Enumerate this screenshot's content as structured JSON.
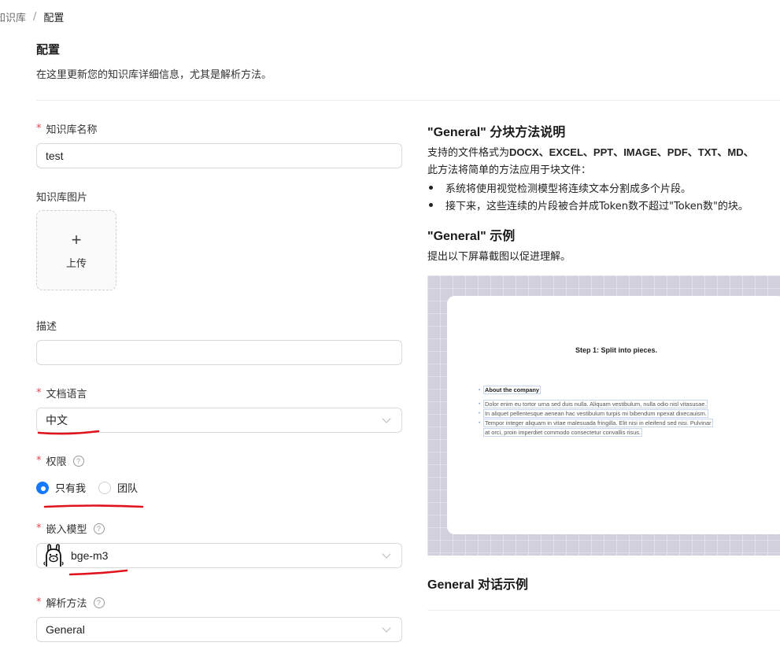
{
  "breadcrumb": {
    "parent": "知识库",
    "separator": "/",
    "current": "配置"
  },
  "header": {
    "title": "配置",
    "subtitle": "在这里更新您的知识库详细信息，尤其是解析方法。"
  },
  "form": {
    "name": {
      "label": "知识库名称",
      "value": "test"
    },
    "image": {
      "label": "知识库图片",
      "upload_icon": "+",
      "upload_label": "上传"
    },
    "description": {
      "label": "描述",
      "value": ""
    },
    "language": {
      "label": "文档语言",
      "value": "中文"
    },
    "permission": {
      "label": "权限",
      "help_icon": "?",
      "options": [
        {
          "label": "只有我",
          "selected": true
        },
        {
          "label": "团队",
          "selected": false
        }
      ]
    },
    "embedding": {
      "label": "嵌入模型",
      "help_icon": "?",
      "value": "bge-m3",
      "icon": "llama-icon"
    },
    "parser": {
      "label": "解析方法",
      "help_icon": "?",
      "value": "General"
    },
    "required_mark": "*"
  },
  "guide": {
    "method_title": "\"General\" 分块方法说明",
    "formats_prefix": "支持的文件格式为",
    "formats": "DOCX、EXCEL、PPT、IMAGE、PDF、TXT、MD、",
    "method_desc": "此方法将简单的方法应用于块文件：",
    "bullets": [
      "系统将使用视觉检测模型将连续文本分割成多个片段。",
      "接下来，这些连续的片段被合并成Token数不超过\"Token数\"的块。"
    ],
    "example_title": "\"General\" 示例",
    "example_desc": "提出以下屏幕截图以促进理解。",
    "example_image": {
      "step_title": "Step 1: Split into pieces.",
      "heading": "About the company",
      "lines": [
        "Dolor enim eu tortor urna sed duis nulla. Aliquam vestibulum, nulla odio nisl vitasusae.",
        "In aliquet pellentesque aenean hac vestibulum turpis mi bibendum npexat dixecauism.",
        "Tempor integer aliquam in vitae malesuada fringilla. Elit nisi in eleifend sed nisi. Pulvinar",
        "at orci, proin imperdiet commodo consectetur convallis risus."
      ]
    },
    "dialog_title": "General 对话示例"
  },
  "colors": {
    "primary": "#1677ff",
    "required": "#e5484d",
    "annotation": "#e0121e",
    "example_bg": "#d3d0dd"
  }
}
